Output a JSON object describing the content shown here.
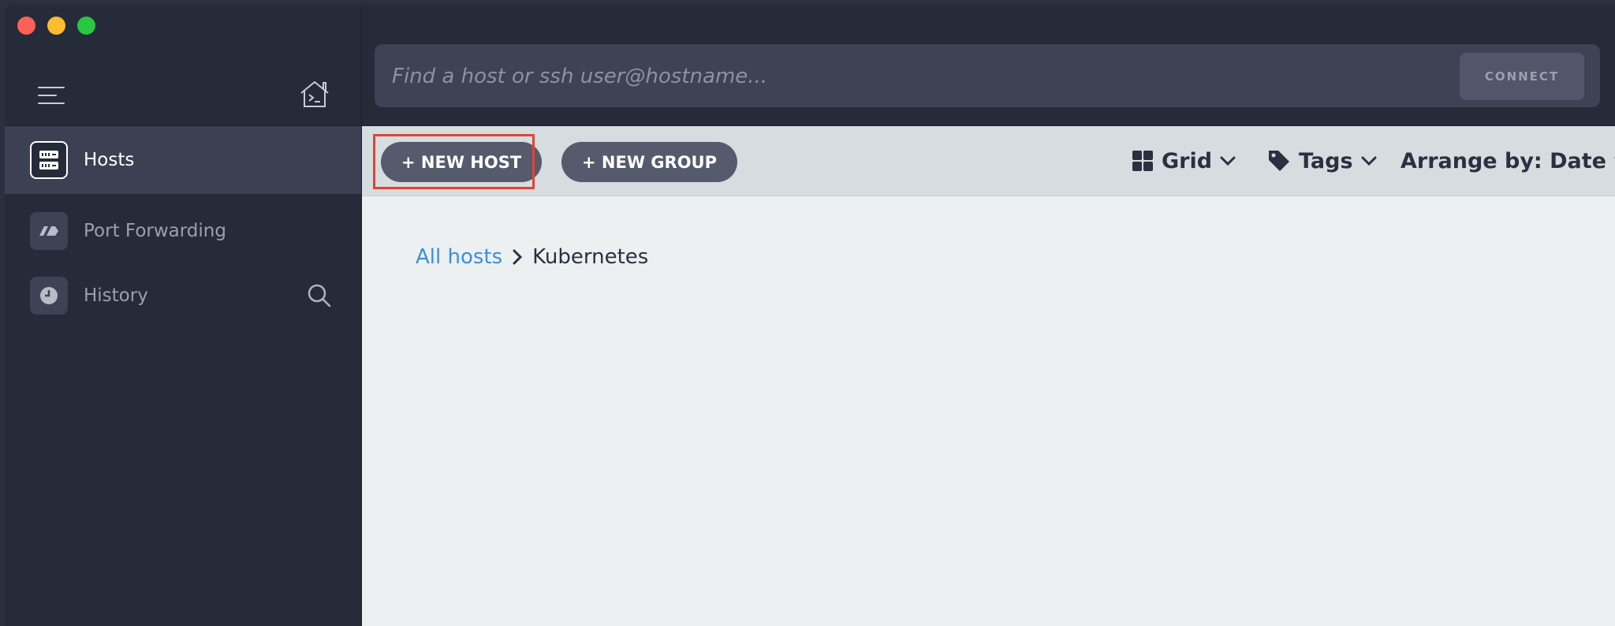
{
  "window": {
    "traffic_lights": [
      "close",
      "minimize",
      "zoom"
    ]
  },
  "sidebar": {
    "items": [
      {
        "label": "Hosts",
        "icon": "server-icon",
        "active": true
      },
      {
        "label": "Port Forwarding",
        "icon": "port-forwarding-icon",
        "active": false
      },
      {
        "label": "History",
        "icon": "clock-icon",
        "active": false
      }
    ]
  },
  "search": {
    "placeholder": "Find a host or ssh user@hostname...",
    "value": "",
    "connect_label": "CONNECT"
  },
  "toolbar": {
    "new_host_label": "+ NEW HOST",
    "new_group_label": "+ NEW GROUP",
    "view_label": "Grid",
    "tags_label": "Tags",
    "arrange_label": "Arrange by: Date"
  },
  "breadcrumb": {
    "root": "All hosts",
    "current": "Kubernetes"
  },
  "colors": {
    "highlight": "#e5432f",
    "link": "#3a8fe0",
    "sidebar_bg": "#262b3a",
    "toolbar_bg": "#d5dde1",
    "content_bg": "#ecf0f1"
  }
}
